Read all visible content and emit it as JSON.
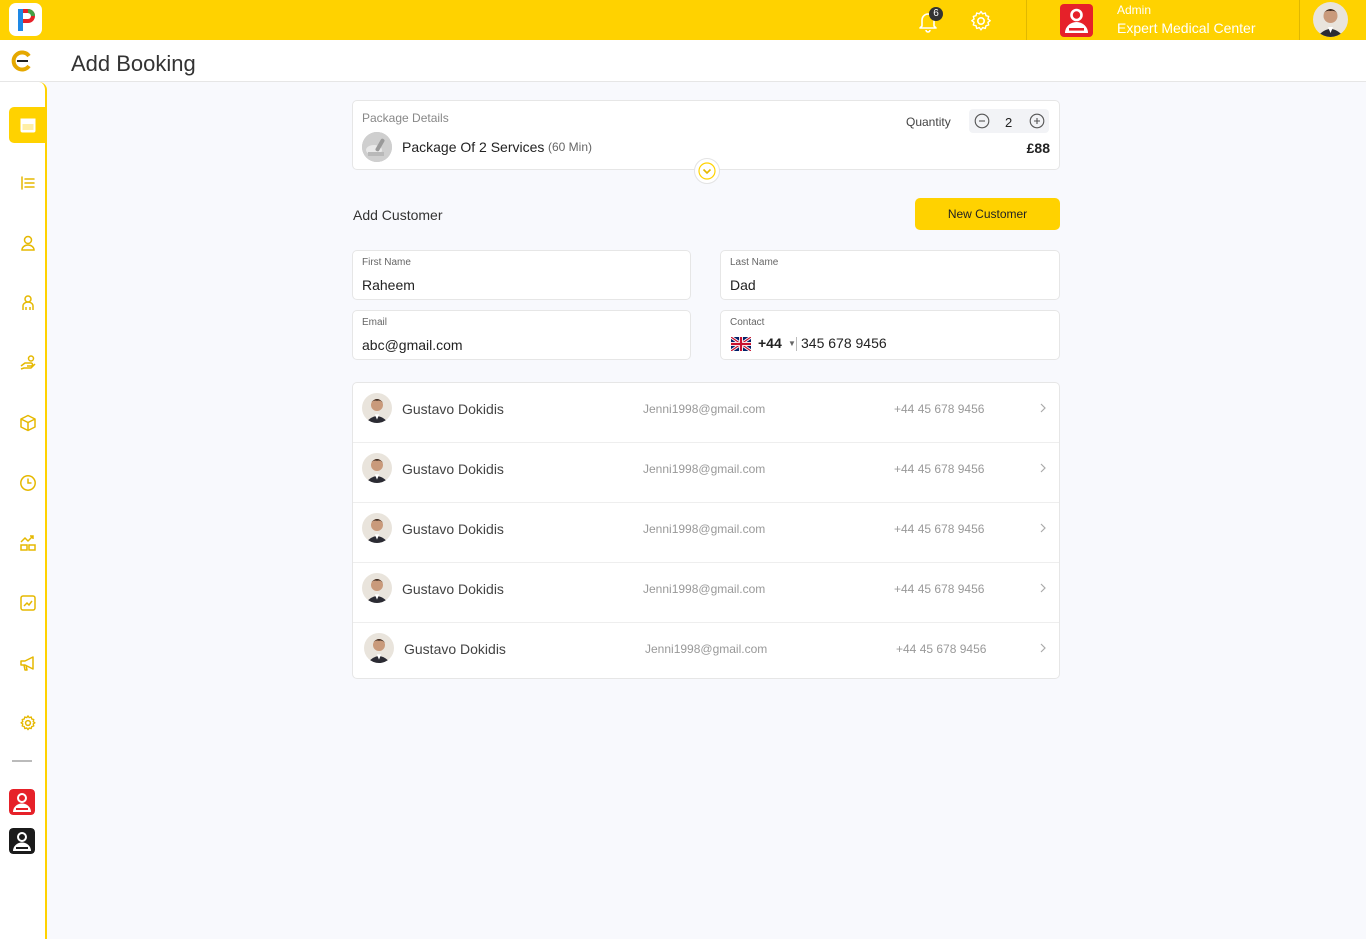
{
  "topbar": {
    "notification_count": "6",
    "org_role": "Admin",
    "org_name": "Expert Medical Center"
  },
  "header": {
    "title": "Add Booking"
  },
  "sidebar": {
    "items": [
      {
        "icon": "calendar-icon",
        "active": true
      },
      {
        "icon": "list-icon"
      },
      {
        "icon": "user-icon"
      },
      {
        "icon": "staff-icon"
      },
      {
        "icon": "services-icon"
      },
      {
        "icon": "package-icon"
      },
      {
        "icon": "clock-icon"
      },
      {
        "icon": "finance-icon"
      },
      {
        "icon": "analytics-icon"
      },
      {
        "icon": "megaphone-icon"
      },
      {
        "icon": "gear-icon"
      }
    ],
    "apps": [
      "red-app-icon",
      "black-app-icon"
    ]
  },
  "package": {
    "label": "Package Details",
    "name": "Package Of 2 Services",
    "duration": "(60 Min)",
    "quantity_label": "Quantity",
    "quantity": "2",
    "price": "£88"
  },
  "customer": {
    "title": "Add Customer",
    "new_button": "New Customer",
    "first_name_label": "First Name",
    "first_name": "Raheem",
    "last_name_label": "Last Name",
    "last_name": "Dad",
    "email_label": "Email",
    "email": "abc@gmail.com",
    "contact_label": "Contact",
    "dial_code": "+44",
    "contact": "345 678 9456"
  },
  "customers": [
    {
      "name": "Gustavo Dokidis",
      "email": "Jenni1998@gmail.com",
      "phone": "+44 45 678 9456"
    },
    {
      "name": "Gustavo Dokidis",
      "email": "Jenni1998@gmail.com",
      "phone": "+44 45 678 9456"
    },
    {
      "name": "Gustavo Dokidis",
      "email": "Jenni1998@gmail.com",
      "phone": "+44 45 678 9456"
    },
    {
      "name": "Gustavo Dokidis",
      "email": "Jenni1998@gmail.com",
      "phone": "+44 45 678 9456"
    },
    {
      "name": "Gustavo Dokidis",
      "email": "Jenni1998@gmail.com",
      "phone": "+44 45 678 9456"
    }
  ],
  "colors": {
    "accent": "#ffd200",
    "brand_red": "#e62129",
    "text": "#222222"
  }
}
